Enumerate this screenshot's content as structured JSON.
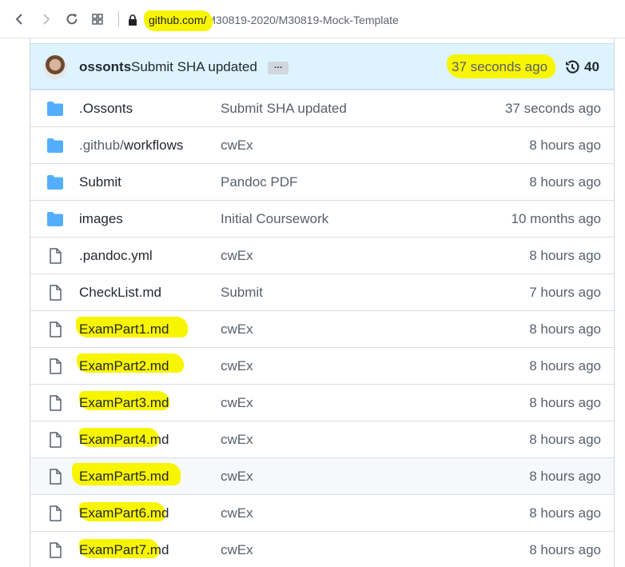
{
  "browser": {
    "host": "github.com/",
    "path": "M30819-2020/M30819-Mock-Template"
  },
  "commit": {
    "author": "ossonts",
    "message": "Submit SHA updated",
    "ellipsis": "…",
    "time": "37 seconds ago",
    "history_count": "40"
  },
  "files": [
    {
      "type": "folder",
      "name": ".Ossonts",
      "message": "Submit SHA updated",
      "age": "37 seconds ago"
    },
    {
      "type": "folder",
      "name_dim": ".github/",
      "name": "workflows",
      "message": "cwEx",
      "age": "8 hours ago"
    },
    {
      "type": "folder",
      "name": "Submit",
      "message": "Pandoc PDF",
      "age": "8 hours ago"
    },
    {
      "type": "folder",
      "name": "images",
      "message": "Initial Coursework",
      "age": "10 months ago"
    },
    {
      "type": "file",
      "name": ".pandoc.yml",
      "message": "cwEx",
      "age": "8 hours ago"
    },
    {
      "type": "file",
      "name": "CheckList.md",
      "message": "Submit",
      "age": "7 hours ago"
    },
    {
      "type": "file",
      "name": "ExamPart1.md",
      "message": "cwEx",
      "age": "8 hours ago"
    },
    {
      "type": "file",
      "name": "ExamPart2.md",
      "message": "cwEx",
      "age": "8 hours ago"
    },
    {
      "type": "file",
      "name": "ExamPart3.md",
      "message": "cwEx",
      "age": "8 hours ago"
    },
    {
      "type": "file",
      "name": "ExamPart4.md",
      "message": "cwEx",
      "age": "8 hours ago"
    },
    {
      "type": "file",
      "name": "ExamPart5.md",
      "message": "cwEx",
      "age": "8 hours ago"
    },
    {
      "type": "file",
      "name": "ExamPart6.md",
      "message": "cwEx",
      "age": "8 hours ago"
    },
    {
      "type": "file",
      "name": "ExamPart7.md",
      "message": "cwEx",
      "age": "8 hours ago"
    }
  ],
  "colors": {
    "highlight": "#f8f500",
    "folder": "#54aeff",
    "file_icon": "#57606a",
    "commit_bar": "#ddf4ff"
  }
}
